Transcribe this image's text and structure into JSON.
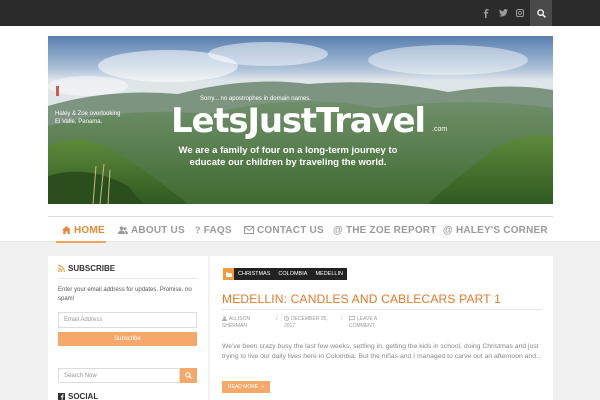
{
  "top_bar": {
    "social_icons": [
      "facebook-icon",
      "twitter-icon",
      "instagram-icon"
    ],
    "search_icon": "search-icon"
  },
  "banner": {
    "tagline_small": "Sorry... no apostrophes in domain names.",
    "title": "LetsJustTravel",
    "title_suffix": ".com",
    "subtitle_line1": "We are a family of four on a long-term journey to",
    "subtitle_line2": "educate our children by traveling the world.",
    "caption": "Haley & Zoe overlooking El Valle, Panama."
  },
  "nav": {
    "items": [
      {
        "label": "HOME",
        "icon": "home-icon",
        "active": true
      },
      {
        "label": "ABOUT US",
        "icon": "users-icon"
      },
      {
        "label": "FAQS",
        "icon": "question-icon"
      },
      {
        "label": "CONTACT US",
        "icon": "envelope-icon"
      },
      {
        "label": "THE ZOE REPORT",
        "icon": "at-icon"
      },
      {
        "label": "HALEY'S CORNER",
        "icon": "at-icon"
      }
    ]
  },
  "sidebar": {
    "subscribe_title": "SUBSCRIBE",
    "subscribe_desc": "Enter your email address for updates. Promise, no spam!",
    "email_placeholder": "Email Address",
    "subscribe_button": "Subscribe",
    "search_placeholder": "Search Now",
    "social_title": "SOCIAL"
  },
  "post": {
    "tags": [
      "CHRISTMAS",
      "COLOMBIA",
      "MEDELLIN"
    ],
    "title": "MEDELLIN: CANDLES AND CABLECARS PART 1",
    "author_line1": "ALLISON",
    "author_line2": "SHERMAN",
    "date_line1": "DECEMBER 25,",
    "date_line2": "2017",
    "comment_line1": "LEAVE A",
    "comment_line2": "COMMENT",
    "excerpt": "We've been crazy busy the last few weeks, settling in, getting the kids in school, doing Christmas and just trying to live our daily lives here in Colombia. But the niñas and I managed to carve out an afternoon and...",
    "read_more": "READ MORE"
  },
  "colors": {
    "accent": "#f4a96a",
    "accent_dark": "#e07a28",
    "topbar": "#2b2b2b"
  }
}
